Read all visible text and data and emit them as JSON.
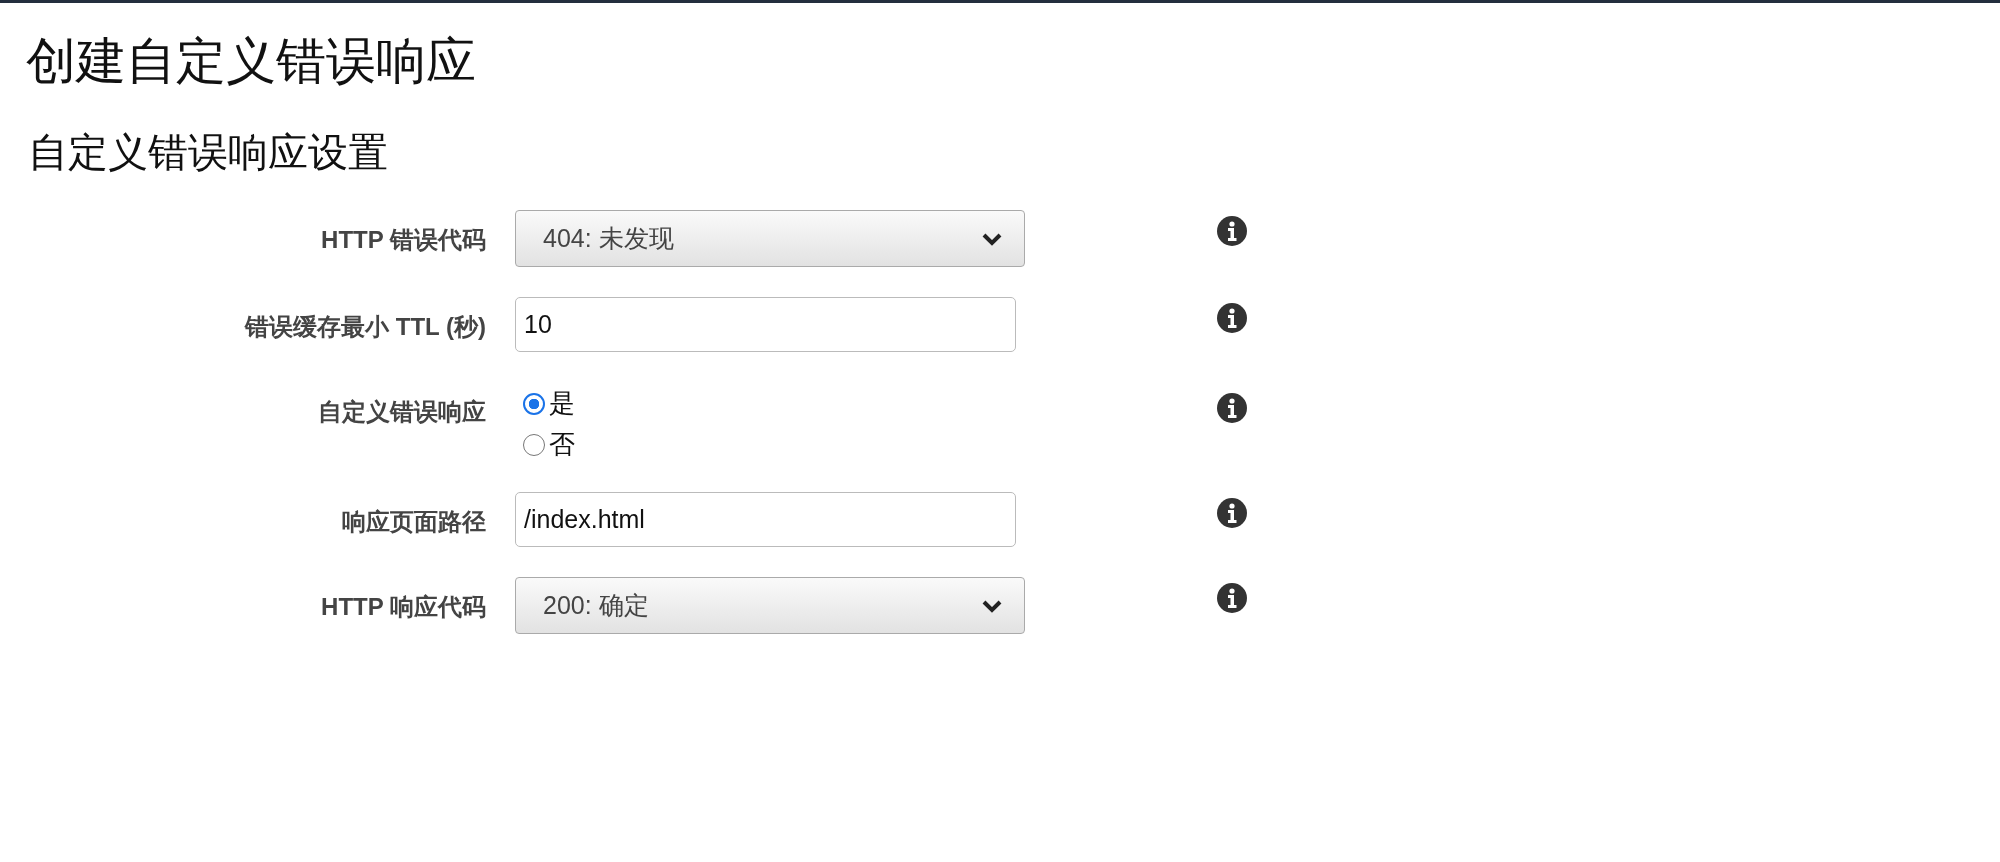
{
  "title": "创建自定义错误响应",
  "section": {
    "heading": "自定义错误响应设置",
    "fields": [
      {
        "kind": "select",
        "label": "HTTP 错误代码",
        "value": "404: 未发现"
      },
      {
        "kind": "text",
        "label": "错误缓存最小 TTL (秒)",
        "value": "10"
      },
      {
        "kind": "radio",
        "label": "自定义错误响应",
        "options": [
          {
            "label": "是",
            "selected": true
          },
          {
            "label": "否",
            "selected": false
          }
        ]
      },
      {
        "kind": "text",
        "label": "响应页面路径",
        "value": "/index.html"
      },
      {
        "kind": "select",
        "label": "HTTP 响应代码",
        "value": "200: 确定"
      }
    ]
  }
}
